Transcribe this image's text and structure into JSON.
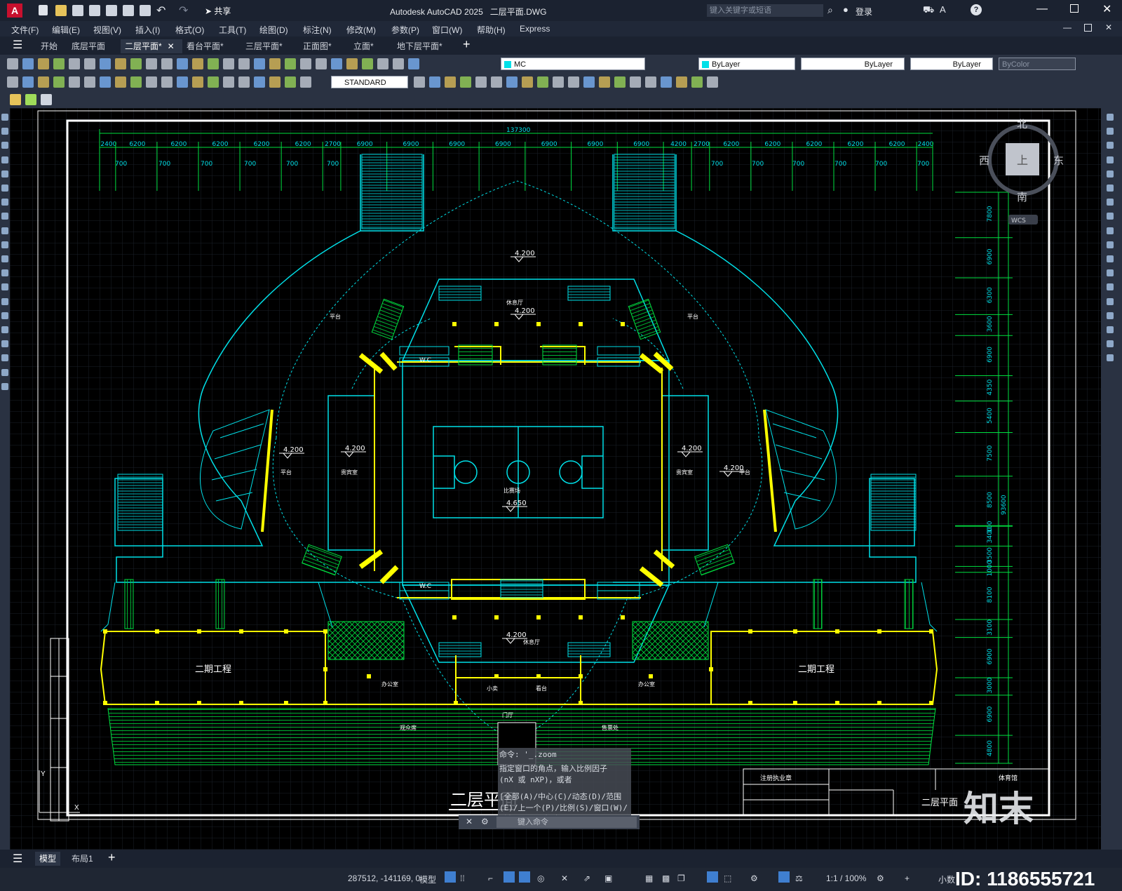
{
  "app": {
    "title": "Autodesk AutoCAD 2025",
    "file": "二层平面.DWG",
    "share_label": "共享",
    "search_placeholder": "键入关键字或短语",
    "login_label": "登录"
  },
  "menu": [
    "文件(F)",
    "编辑(E)",
    "视图(V)",
    "插入(I)",
    "格式(O)",
    "工具(T)",
    "绘图(D)",
    "标注(N)",
    "修改(M)",
    "参数(P)",
    "窗口(W)",
    "帮助(H)",
    "Express"
  ],
  "tabs": [
    "开始",
    "底层平面",
    "二层平面*",
    "看台平面*",
    "三层平面*",
    "正面图*",
    "立面*",
    "地下层平面*"
  ],
  "toolbar": {
    "layer_name": "MC",
    "color": "ByLayer",
    "linetype": "ByLayer",
    "lineweight": "ByLayer",
    "plotstyle": "ByColor",
    "textstyle": "STANDARD"
  },
  "viewcube": {
    "north": "北",
    "south": "南",
    "east": "东",
    "west": "西",
    "top": "上",
    "wcs": "WCS"
  },
  "drawing": {
    "title": "二层平面",
    "total_width": "137300",
    "top_dims": [
      "2400",
      "6200",
      "6200",
      "6200",
      "6200",
      "6200",
      "2700",
      "6900",
      "6900",
      "6900",
      "6900",
      "6900",
      "6900",
      "6900",
      "4200",
      "2700",
      "6200",
      "6200",
      "6200",
      "6200",
      "6200",
      "2400"
    ],
    "sub_dims": [
      "700",
      "700",
      "700",
      "700",
      "700",
      "700",
      "700",
      "700",
      "700",
      "700",
      "700",
      "700"
    ],
    "right_dims": [
      "7800",
      "6900",
      "6300",
      "3600",
      "6900",
      "4350",
      "5400",
      "7500",
      "8500",
      "100",
      "3400",
      "3500",
      "1000",
      "8100",
      "3100",
      "6900",
      "3000",
      "6900",
      "4800"
    ],
    "right_total": "93600",
    "elevations": [
      "4.200",
      "4.200",
      "4.200",
      "4.200",
      "4.200",
      "4.200",
      "4.650",
      "4.200"
    ],
    "labels": {
      "phase2_left": "二期工程",
      "phase2_right": "二期工程",
      "wc": "W.C",
      "court": "比赛场",
      "platform": "平台",
      "lounge": "休息厅",
      "rest": "贵宾室",
      "office": "办公室",
      "shop": "小卖",
      "stand": "看台",
      "hall": "门厅",
      "public": "观众席",
      "ticket": "售票处"
    },
    "titleblock": {
      "company": "注册执业章",
      "name": "二层平面",
      "project": "体育馆"
    }
  },
  "command": {
    "history": [
      "命令: '_.zoom",
      "指定窗口的角点，输入比例因子 (nX 或 nXP)，或者",
      "[全部(A)/中心(C)/动态(D)/范围(E)/上一个(P)/比例(S)/窗口(W)/对象(O)] <实时>: _e"
    ],
    "placeholder": "键入命令"
  },
  "layouts": [
    "模型",
    "布局1"
  ],
  "status": {
    "coords": "287512, -141169, 0",
    "model": "模型",
    "scale": "1:1 / 100%",
    "units": "小数"
  },
  "watermark": {
    "brand": "知末",
    "id": "ID: 1186555721"
  },
  "colors": {
    "cyan": "#00e0e8",
    "yellow": "#ffff00",
    "green": "#00e040",
    "white": "#ffffff",
    "bg": "#000000"
  }
}
